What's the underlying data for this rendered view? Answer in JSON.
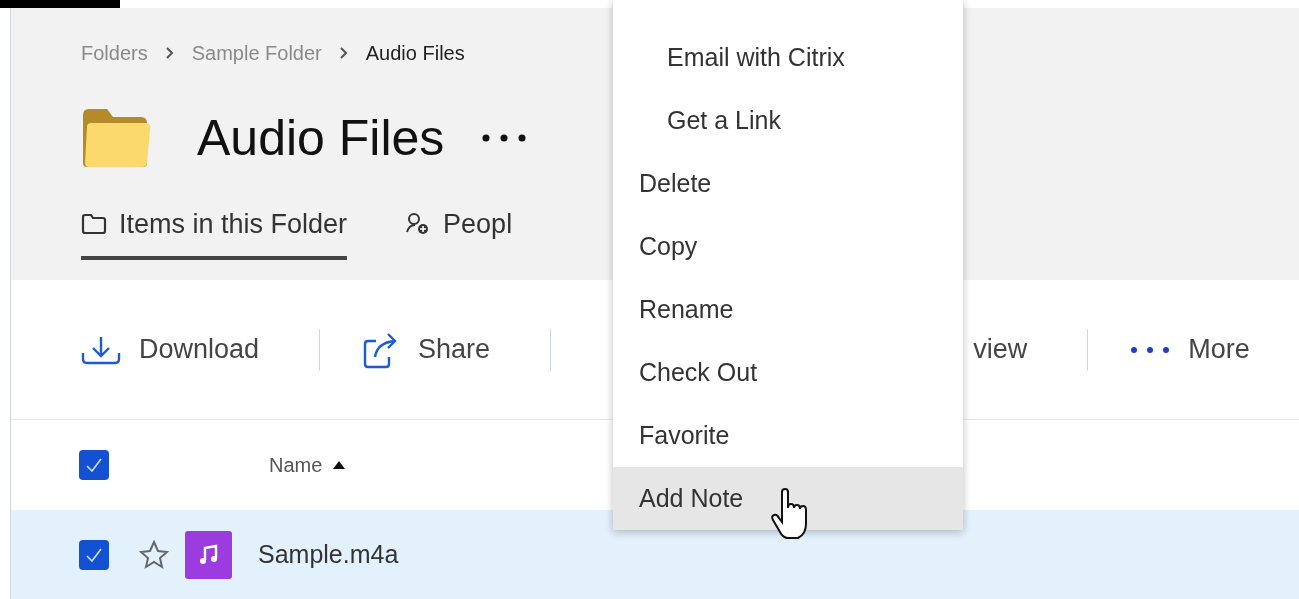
{
  "breadcrumb": [
    {
      "label": "Folders",
      "current": false
    },
    {
      "label": "Sample Folder",
      "current": false
    },
    {
      "label": "Audio Files",
      "current": true
    }
  ],
  "title": "Audio Files",
  "tabs": [
    {
      "label": "Items in this Folder",
      "kind": "folder",
      "selected": true
    },
    {
      "label": "Peopl",
      "kind": "people",
      "selected": false
    }
  ],
  "toolbar": [
    {
      "label": "Download",
      "kind": "download"
    },
    {
      "label": "Share",
      "kind": "share"
    },
    {
      "label": "view",
      "kind": "partial"
    },
    {
      "label": "More",
      "kind": "more"
    }
  ],
  "table": {
    "columns": [
      {
        "label": "Name",
        "sorted": true
      }
    ],
    "all_checked": true,
    "rows": [
      {
        "name": "Sample.m4a",
        "checked": true,
        "favorite": false,
        "selected": true
      }
    ]
  },
  "menu": [
    {
      "label": "Email with Citrix",
      "kind": "sub",
      "selected": false
    },
    {
      "label": "Get a Link",
      "kind": "sub",
      "selected": false
    },
    {
      "label": "Delete",
      "kind": "item",
      "selected": false
    },
    {
      "label": "Copy",
      "kind": "item",
      "selected": false
    },
    {
      "label": "Rename",
      "kind": "item",
      "selected": false
    },
    {
      "label": "Check Out",
      "kind": "item",
      "selected": false
    },
    {
      "label": "Favorite",
      "kind": "item",
      "selected": false
    },
    {
      "label": "Add Note",
      "kind": "item",
      "selected": true
    }
  ]
}
